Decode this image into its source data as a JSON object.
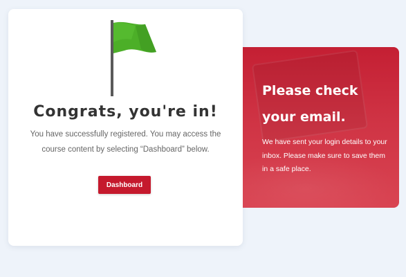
{
  "congrats": {
    "title": "Congrats, you're in!",
    "message": "You have successfully registered. You may access the course content by selecting “Dashboard” below.",
    "dashboard_button": "Dashboard",
    "flag_icon": "green-flag-icon",
    "flag_color": "#4caf28"
  },
  "email_notice": {
    "heading": "Please check your email.",
    "message": "We have sent your login details to your inbox. Please make sure to save them in a safe place."
  },
  "colors": {
    "background": "#eef3fa",
    "accent": "#c5192d",
    "panel": "#c41f33"
  }
}
